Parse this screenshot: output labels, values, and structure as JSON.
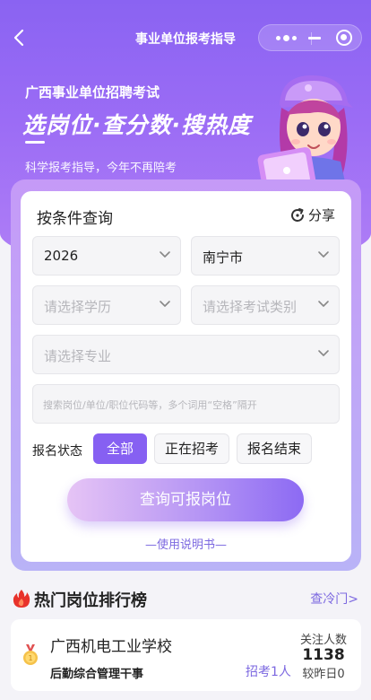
{
  "nav": {
    "title": "事业单位报考指导",
    "back_icon": "chevron-left-icon",
    "more_icon": "more-dots-icon",
    "minimize_icon": "minimize-icon",
    "close_icon": "target-close-icon"
  },
  "hero": {
    "subtitle": "广西事业单位招聘考试",
    "headline": "选岗位·查分数·搜热度",
    "tagline": "科学报考指导，今年不再陪考",
    "accent_color": "#8a63f2"
  },
  "query": {
    "title": "按条件查询",
    "share_label": "分享",
    "share_icon": "refresh-share-icon",
    "year": "2026",
    "city": "南宁市",
    "education_placeholder": "请选择学历",
    "exam_type_placeholder": "请选择考试类别",
    "major_placeholder": "请选择专业",
    "search_placeholder": "搜索岗位/单位/职位代码等，多个词用“空格”隔开",
    "status_label": "报名状态",
    "status_options": [
      "全部",
      "正在招考",
      "报名结束"
    ],
    "status_selected": "全部",
    "submit_label": "查询可报岗位",
    "manual_link": "—使用说明书—"
  },
  "hot": {
    "title": "热门岗位排行榜",
    "cold_link": "查冷门>",
    "items": [
      {
        "name": "广西机电工业学校",
        "position": "后勤综合管理干事",
        "recruit": "招考1人",
        "follow_label": "关注人数",
        "follow_count": "1138",
        "compare": "较昨日0"
      }
    ]
  }
}
